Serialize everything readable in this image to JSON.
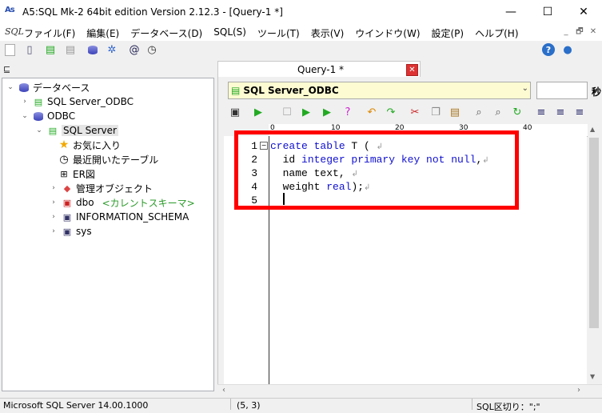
{
  "window": {
    "app_icon_text": "As",
    "title": "A5:SQL Mk-2 64bit edition Version 2.12.3 - [Query-1 *]",
    "minimize": "—",
    "maximize": "☐",
    "close": "✕"
  },
  "menu": {
    "sql_logo": "SQL",
    "items": [
      "ファイル(F)",
      "編集(E)",
      "データベース(D)",
      "SQL(S)",
      "ツール(T)",
      "表示(V)",
      "ウインドウ(W)",
      "設定(P)",
      "ヘルプ(H)"
    ],
    "mdi_minimize": "_",
    "mdi_restore": "🗗",
    "mdi_close": "✕"
  },
  "tree": {
    "root": "データベース",
    "conn_sqlserver_odbc": "SQL Server_ODBC",
    "odbc": "ODBC",
    "sql_server": "SQL Server",
    "favorites": "お気に入り",
    "recent_tables": "最近開いたテーブル",
    "er_diagram": "ER図",
    "admin_objects": "管理オブジェクト",
    "schema_dbo": "dbo",
    "current_schema": "<カレントスキーマ>",
    "schema_info": "INFORMATION_SCHEMA",
    "schema_sys": "sys"
  },
  "editor": {
    "tab_label": "Query-1 *",
    "tab_close": "✕",
    "connection": "SQL Server_ODBC",
    "seconds_label": "秒",
    "ruler_marks": [
      "0",
      "10",
      "20",
      "30",
      "40"
    ],
    "line_numbers": [
      "1",
      "2",
      "3",
      "4",
      "5"
    ],
    "line1_kw": "create table",
    "line1_rest": " T (",
    "line2_pre": "  id ",
    "line2_kw": "integer primary key not null",
    "line2_rest": ",",
    "line3": "  name text,",
    "line4_pre": "  weight ",
    "line4_kw": "real",
    "line4_rest": ");",
    "newline_mark": "↲"
  },
  "status": {
    "server_version": "Microsoft SQL Server 14.00.1000",
    "cursor_position": "(5, 3)",
    "sql_separator": "SQL区切り：\";\""
  },
  "colors": {
    "keyword": "#1010d0",
    "highlight_border": "#ff0000",
    "connection_bg": "#fdfbd2"
  }
}
